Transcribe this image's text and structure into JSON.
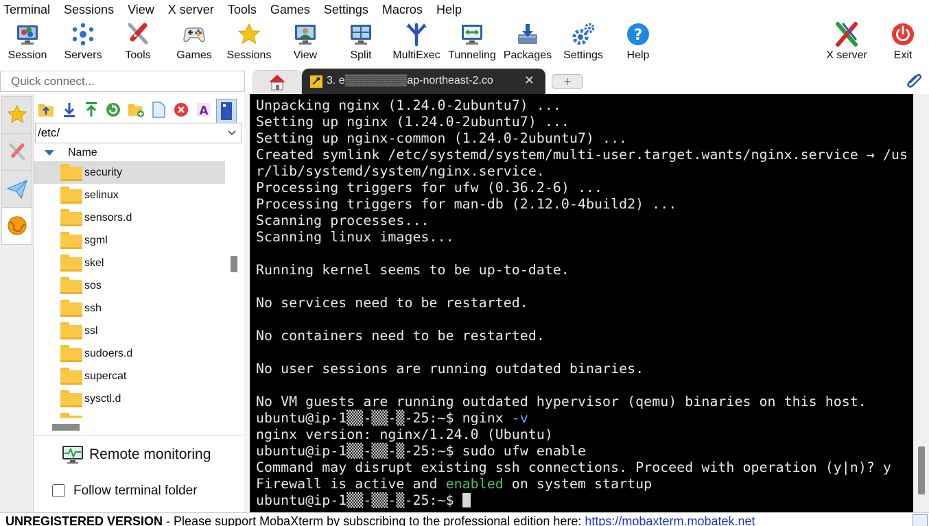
{
  "menu": [
    "Terminal",
    "Sessions",
    "View",
    "X server",
    "Tools",
    "Games",
    "Settings",
    "Macros",
    "Help"
  ],
  "toolbar": [
    {
      "label": "Session",
      "icon": "session-icon"
    },
    {
      "label": "Servers",
      "icon": "servers-icon"
    },
    {
      "label": "Tools",
      "icon": "tools-icon"
    },
    {
      "label": "Games",
      "icon": "games-icon"
    },
    {
      "label": "Sessions",
      "icon": "star-icon"
    },
    {
      "label": "View",
      "icon": "view-icon"
    },
    {
      "label": "Split",
      "icon": "split-icon"
    },
    {
      "label": "MultiExec",
      "icon": "multiexec-icon"
    },
    {
      "label": "Tunneling",
      "icon": "tunneling-icon"
    },
    {
      "label": "Packages",
      "icon": "packages-icon"
    },
    {
      "label": "Settings",
      "icon": "settings-icon"
    },
    {
      "label": "Help",
      "icon": "help-icon"
    },
    {
      "label": "X server",
      "icon": "x-server-icon"
    },
    {
      "label": "Exit",
      "icon": "power-icon"
    }
  ],
  "quick_connect": {
    "placeholder": "Quick connect..."
  },
  "tabs": {
    "session_tab": "3. e▒▒▒▒▒▒▒▒ap-northeast-2.co",
    "close": "✕",
    "new_tab": "+"
  },
  "file_browser": {
    "path": "/etc/",
    "column_name": "Name",
    "items": [
      "security",
      "selinux",
      "sensors.d",
      "sgml",
      "skel",
      "sos",
      "ssh",
      "ssl",
      "sudoers.d",
      "supercat",
      "sysctl.d"
    ],
    "selected": "security",
    "remote_monitoring": "Remote monitoring",
    "follow_terminal_folder": "Follow terminal folder",
    "follow_checked": false
  },
  "terminal": {
    "lines": [
      "Unpacking nginx (1.24.0-2ubuntu7) ...",
      "Setting up nginx (1.24.0-2ubuntu7) ...",
      "Setting up nginx-common (1.24.0-2ubuntu7) ...",
      "Created symlink /etc/systemd/system/multi-user.target.wants/nginx.service → /us",
      "r/lib/systemd/system/nginx.service.",
      "Processing triggers for ufw (0.36.2-6) ...",
      "Processing triggers for man-db (2.12.0-4build2) ...",
      "Scanning processes...",
      "Scanning linux images...",
      "",
      "Running kernel seems to be up-to-date.",
      "",
      "No services need to be restarted.",
      "",
      "No containers need to be restarted.",
      "",
      "No user sessions are running outdated binaries.",
      "",
      "No VM guests are running outdated hypervisor (qemu) binaries on this host."
    ],
    "prompt": "ubuntu@ip-1▒▒-▒▒-▒-25:~$ ",
    "cmd1_main": "nginx ",
    "cmd1_flag": "-v",
    "out1": "nginx version: nginx/1.24.0 (Ubuntu)",
    "cmd2": "sudo ufw enable",
    "out2": "Command may disrupt existing ssh connections. Proceed with operation (y|n)? y",
    "out3_a": "Firewall is active and ",
    "out3_b": "enabled",
    "out3_c": " on system startup",
    "colors": {
      "green": "#3cc35a",
      "blue": "#5ab4ff",
      "background": "#000000"
    }
  },
  "status_bar": {
    "bold": "UNREGISTERED VERSION",
    "text": "  -  Please support MobaXterm by subscribing to the professional edition here:  ",
    "link": "https://mobaxterm.mobatek.net"
  }
}
